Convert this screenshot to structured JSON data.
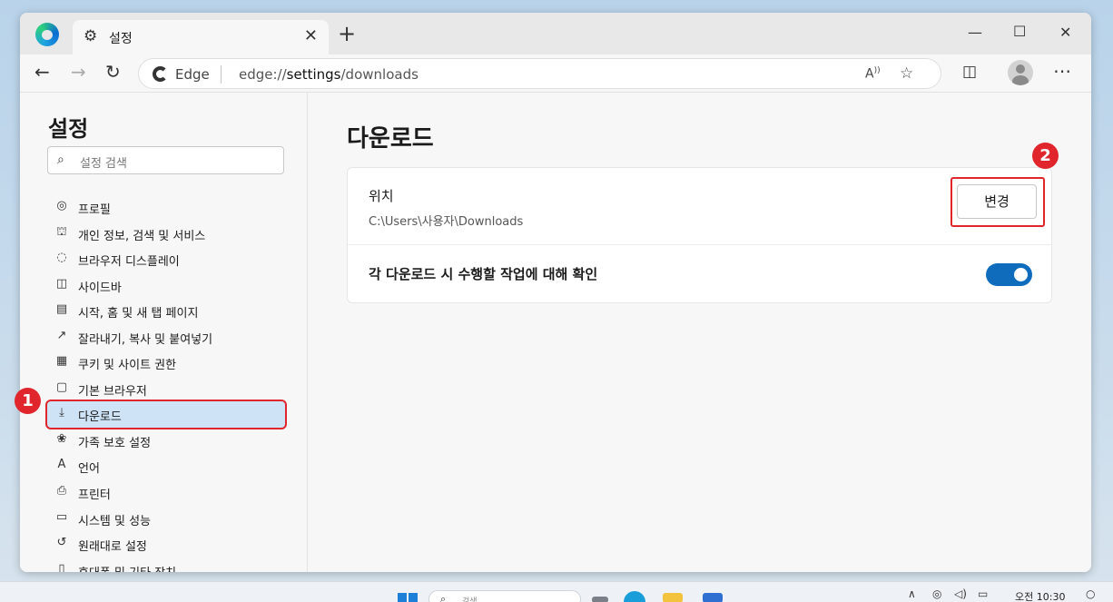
{
  "tab": {
    "title": "설정",
    "icon": "gear-icon"
  },
  "address": {
    "brand": "Edge",
    "url_prefix": "edge://",
    "url_bold": "settings",
    "url_suffix": "/downloads"
  },
  "sidebar": {
    "title": "설정",
    "search_placeholder": "설정 검색",
    "items": [
      {
        "label": "프로필",
        "icon": "profile-icon"
      },
      {
        "label": "개인 정보, 검색 및 서비스",
        "icon": "lock-icon"
      },
      {
        "label": "브라우저 디스플레이",
        "icon": "palette-icon"
      },
      {
        "label": "사이드바",
        "icon": "sidebar-icon"
      },
      {
        "label": "시작, 홈 및 새 탭 페이지",
        "icon": "home-tab-icon"
      },
      {
        "label": "잘라내기, 복사 및 붙여넣기",
        "icon": "share-icon"
      },
      {
        "label": "쿠키 및 사이트 권한",
        "icon": "cookie-icon"
      },
      {
        "label": "기본 브라우저",
        "icon": "default-browser-icon"
      },
      {
        "label": "다운로드",
        "icon": "download-icon",
        "active": true
      },
      {
        "label": "가족 보호 설정",
        "icon": "family-icon"
      },
      {
        "label": "언어",
        "icon": "language-icon"
      },
      {
        "label": "프린터",
        "icon": "printer-icon"
      },
      {
        "label": "시스템 및 성능",
        "icon": "laptop-icon"
      },
      {
        "label": "원래대로 설정",
        "icon": "reset-icon"
      },
      {
        "label": "휴대폰 및 기타 장치",
        "icon": "phone-icon"
      }
    ]
  },
  "main": {
    "title": "다운로드",
    "location_label": "위치",
    "location_path": "C:\\Users\\사용자\\Downloads",
    "change_button": "변경",
    "ask_label": "각 다운로드 시 수행할 작업에 대해 확인",
    "ask_enabled": true
  },
  "markers": {
    "one": "1",
    "two": "2"
  },
  "taskbar": {
    "search_placeholder": "검색",
    "clock_label": "오전 10:30"
  },
  "colors": {
    "accent": "#0f6cbd",
    "highlight": "#e0262c",
    "active_item": "#cfe3f7"
  }
}
